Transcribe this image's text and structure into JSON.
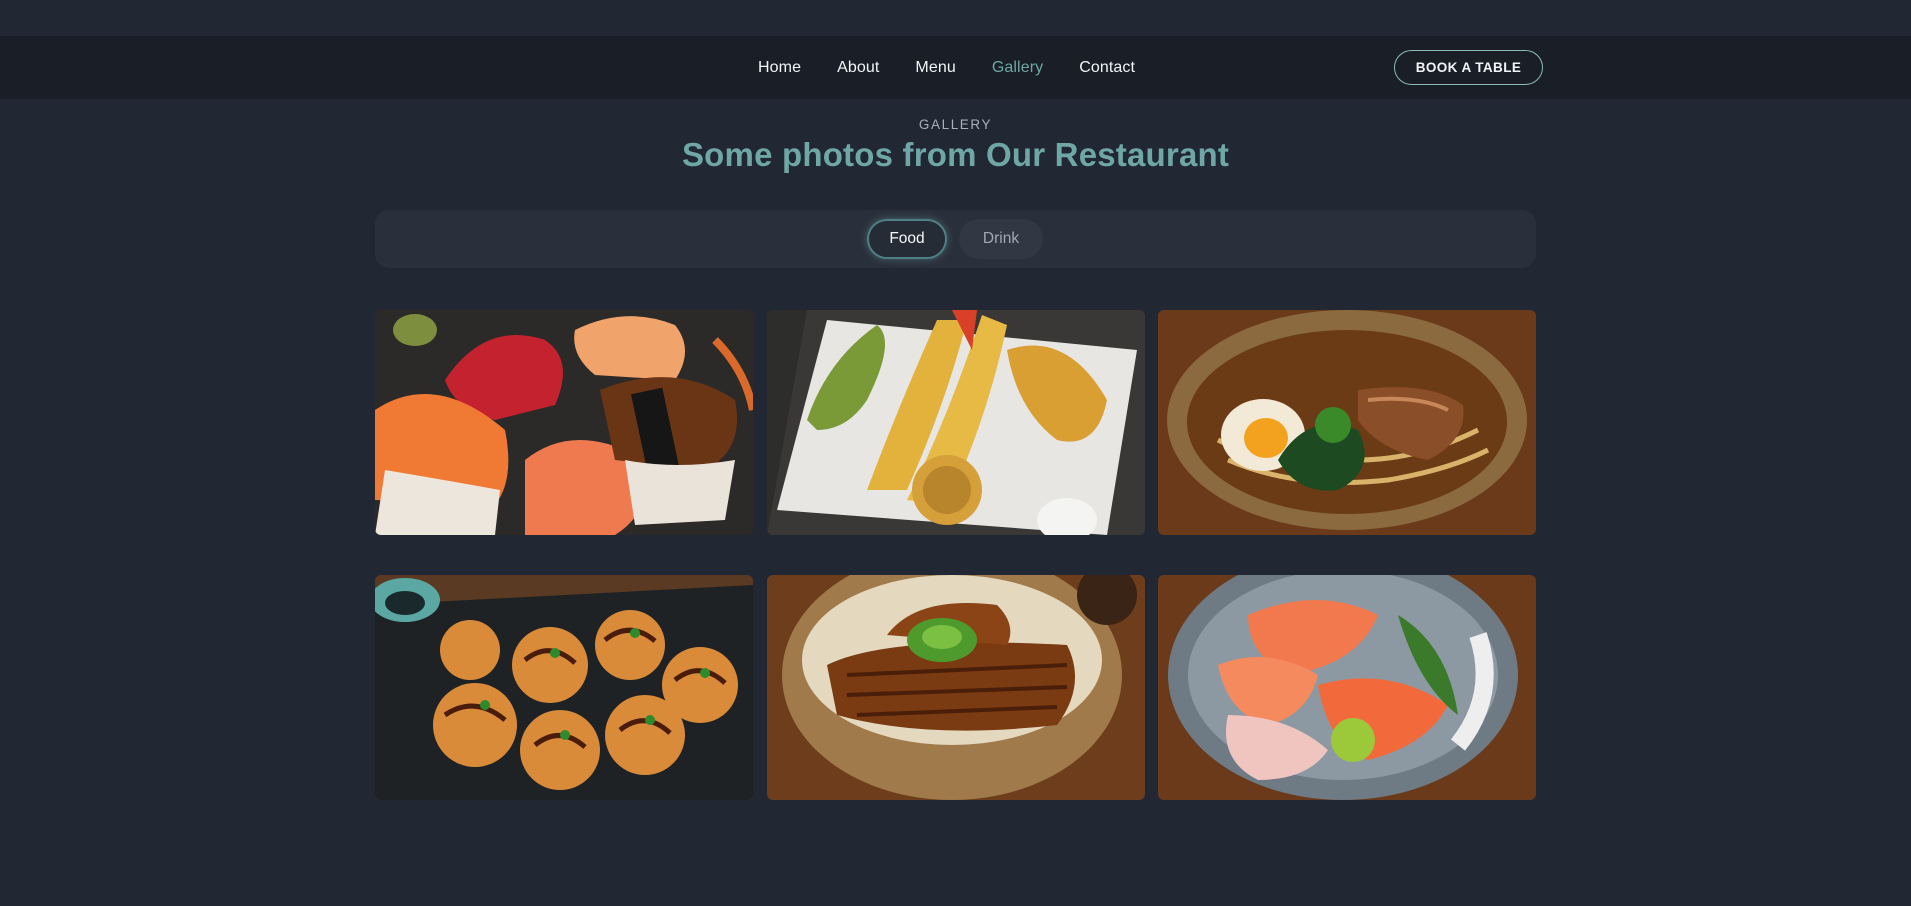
{
  "nav": {
    "links": [
      {
        "label": "Home",
        "active": false
      },
      {
        "label": "About",
        "active": false
      },
      {
        "label": "Menu",
        "active": false
      },
      {
        "label": "Gallery",
        "active": true
      },
      {
        "label": "Contact",
        "active": false
      }
    ],
    "cta_label": "BOOK A TABLE"
  },
  "gallery": {
    "eyebrow": "GALLERY",
    "title": "Some photos from Our Restaurant",
    "filters": [
      {
        "label": "Food",
        "selected": true
      },
      {
        "label": "Drink",
        "selected": false
      }
    ],
    "photos": [
      {
        "subject": "nigiri sushi assortment"
      },
      {
        "subject": "shrimp and vegetable tempura"
      },
      {
        "subject": "ramen bowl with egg and pork"
      },
      {
        "subject": "takoyaki with sauce and sesame"
      },
      {
        "subject": "unagi don eel rice bowl"
      },
      {
        "subject": "sashimi bowl with wasabi"
      }
    ]
  },
  "colors": {
    "background": "#222833",
    "navbar": "#1a1e26",
    "accent": "#6ea7a6",
    "filter_bar": "#2a303b"
  }
}
